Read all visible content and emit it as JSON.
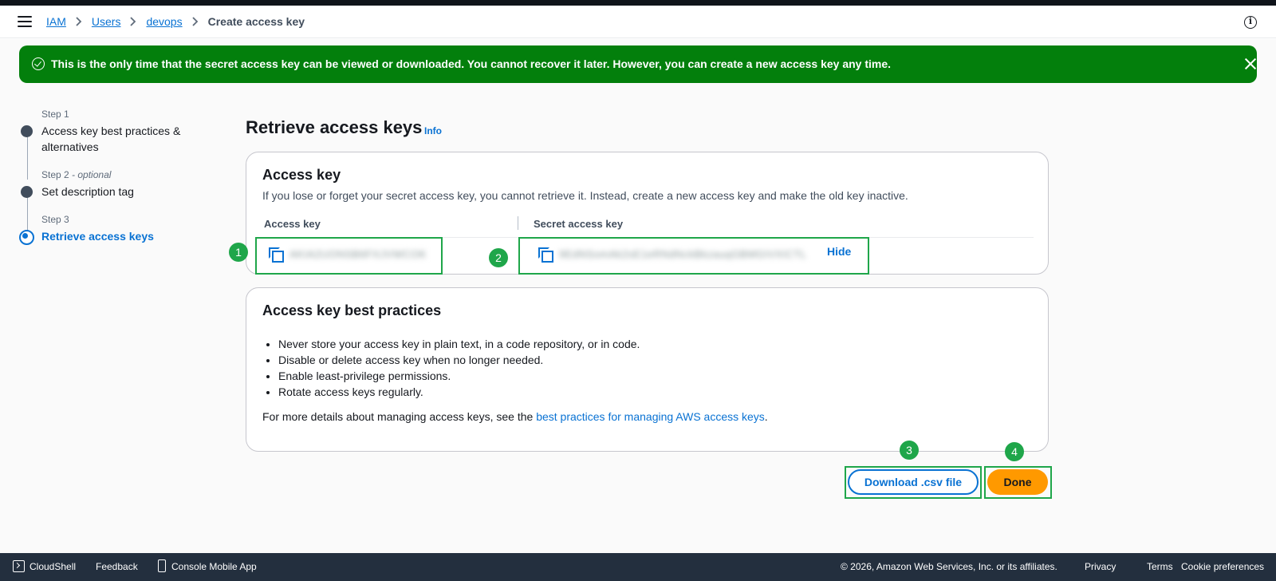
{
  "header": {
    "breadcrumb": [
      "IAM",
      "Users",
      "devops"
    ],
    "current": "Create access key",
    "info_icon": "info-circle-icon"
  },
  "flash": {
    "message": "This is the only time that the secret access key can be viewed or downloaded. You cannot recover it later. However, you can create a new access key any time.",
    "color": "#037f0c"
  },
  "steps": [
    {
      "number": "Step 1",
      "optional": "",
      "title": "Access key best practices & alternatives"
    },
    {
      "number": "Step 2",
      "optional": "- optional",
      "title": "Set description tag"
    },
    {
      "number": "Step 3",
      "optional": "",
      "title": "Retrieve access keys"
    }
  ],
  "page": {
    "title": "Retrieve access keys",
    "info_link": "Info"
  },
  "access_key_card": {
    "title": "Access key",
    "description": "If you lose or forget your secret access key, you cannot retrieve it. Instead, create a new access key and make the old key inactive.",
    "col_access_key": "Access key",
    "col_secret_key": "Secret access key",
    "access_key_value": "AKIA2UONSB6FXJVWCOK",
    "secret_key_value": "9EdNSomAk2sE1eRNdNckBkzauqGBMGIVXICTL",
    "hide_label": "Hide"
  },
  "best_practices_card": {
    "title": "Access key best practices",
    "items": [
      "Never store your access key in plain text, in a code repository, or in code.",
      "Disable or delete access key when no longer needed.",
      "Enable least-privilege permissions.",
      "Rotate access keys regularly."
    ],
    "more_prefix": "For more details about managing access keys, see the ",
    "more_link": "best practices for managing AWS access keys",
    "more_suffix": "."
  },
  "annotations": [
    "1",
    "2",
    "3",
    "4"
  ],
  "buttons": {
    "download": "Download .csv file",
    "done": "Done"
  },
  "footer": {
    "cloudshell": "CloudShell",
    "feedback": "Feedback",
    "mobile_app": "Console Mobile App",
    "copyright": "© 2026, Amazon Web Services, Inc. or its affiliates.",
    "privacy": "Privacy",
    "terms": "Terms",
    "cookies": "Cookie preferences"
  }
}
